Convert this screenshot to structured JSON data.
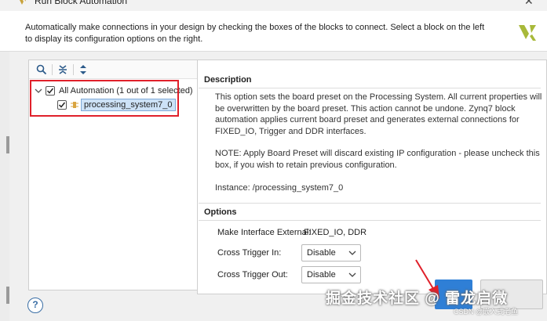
{
  "window": {
    "title": "Run Block Automation",
    "close_glyph": "✕"
  },
  "header": {
    "description": "Automatically make connections in your design by checking the boxes of the blocks to connect. Select a block on the left to display its configuration options on the right.",
    "logo_icon": "vivado-logo-icon"
  },
  "tree": {
    "toolbar": [
      "search-icon",
      "collapse-all-icon",
      "expand-all-icon"
    ],
    "items": [
      {
        "label": "All Automation (1 out of 1 selected)",
        "checked": true,
        "expanded": true
      },
      {
        "label": "processing_system7_0",
        "checked": true,
        "selected": true
      }
    ]
  },
  "detail": {
    "description_heading": "Description",
    "description_p1": "This option sets the board preset on the Processing System. All current properties will be overwritten by the board preset. This action cannot be undone. Zynq7 block automation applies current board preset and generates external connections for FIXED_IO, Trigger and DDR interfaces.",
    "description_p2": "NOTE: Apply Board Preset will discard existing IP configuration - please uncheck this box, if you wish to retain previous configuration.",
    "description_p3": "Instance: /processing_system7_0",
    "options_heading": "Options",
    "make_interface_label": "Make Interface External:",
    "make_interface_value": "FIXED_IO, DDR",
    "cross_trigger_in_label": "Cross Trigger In:",
    "cross_trigger_in_value": "Disable",
    "cross_trigger_out_label": "Cross Trigger Out:",
    "cross_trigger_out_value": "Disable"
  },
  "footer": {
    "help_label": "?"
  },
  "overlay": {
    "watermark": "掘金技术社区 @ 雷龙启微",
    "csdn_mark": "CSDN @嵌入式老鱼"
  },
  "colors": {
    "annotation_red": "#e0202a",
    "selection_bg": "#cde2f7",
    "ok_blue": "#2f7fd6"
  }
}
